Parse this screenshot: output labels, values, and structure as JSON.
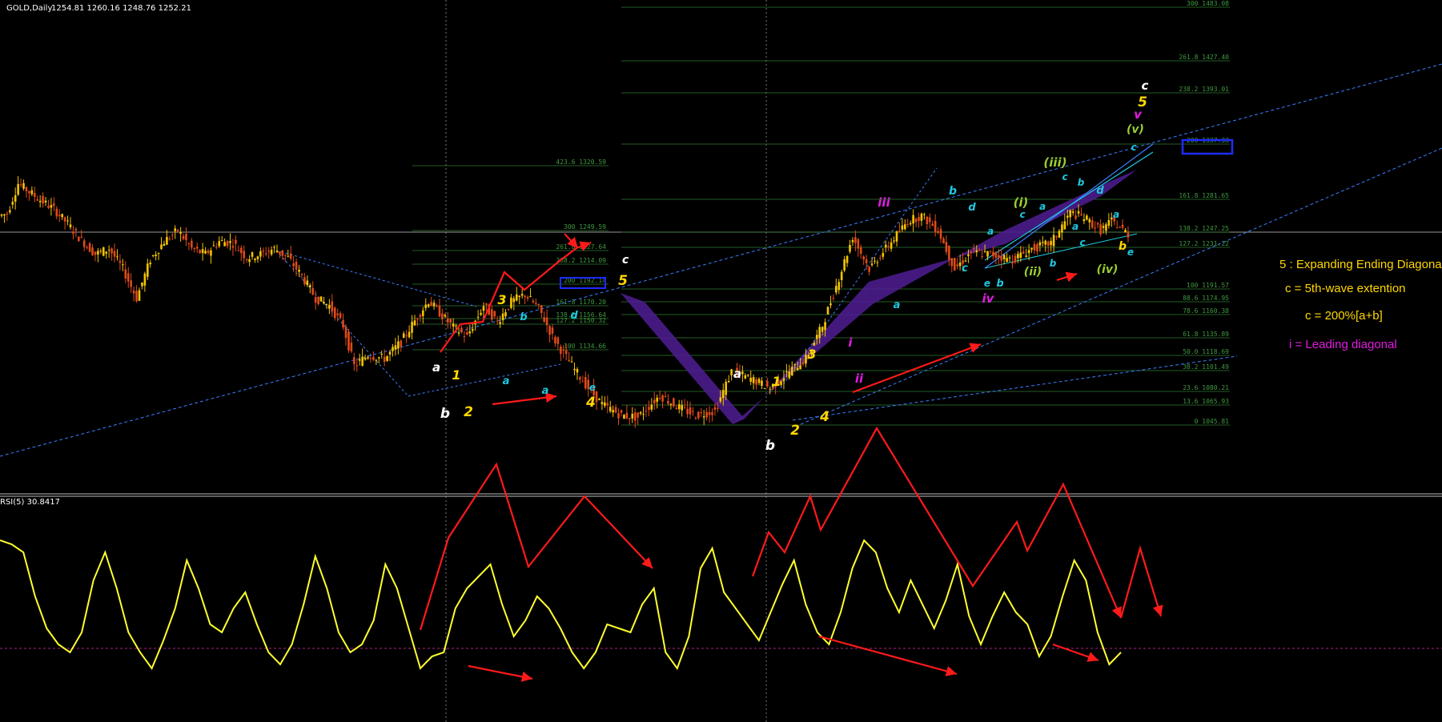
{
  "header": {
    "symbol": "GOLD,Daily",
    "ohlc": "1254.81 1260.16 1248.76 1252.21"
  },
  "rsi": {
    "label": "RSI(5) 30.8417"
  },
  "colors": {
    "background": "#000000",
    "bull": "#f5c400",
    "bear": "#e04a1a",
    "rsi": "#ffff2e",
    "arrows": "#ff1a1a",
    "fib": "#2f7a2f",
    "trend": "#3a7fff",
    "wedge": "#4b1c8c"
  },
  "notes": [
    {
      "text": "5 : Expanding Ending Diagonal",
      "color": "#ffd700"
    },
    {
      "text": "c = 5th-wave extention",
      "color": "#ffd700"
    },
    {
      "text": "c = 200%[a+b]",
      "color": "#ffd700"
    },
    {
      "text": "i = Leading diagonal",
      "color": "#e01ce0"
    }
  ],
  "fib_left": [
    {
      "label": "423.6 1320.59"
    },
    {
      "label": "300 1249.59"
    },
    {
      "label": "261.8 1227.64"
    },
    {
      "label": "238.2 1214.09"
    },
    {
      "label": "200 1192.14"
    },
    {
      "label": "161.8 1170.20"
    },
    {
      "label": "138.2 1156.64"
    },
    {
      "label": "127.2 1150.32"
    },
    {
      "label": "100 1134.66"
    }
  ],
  "fib_right": [
    {
      "label": "300 1483.08"
    },
    {
      "label": "261.8 1427.40"
    },
    {
      "label": "238.2 1393.01"
    },
    {
      "label": "200 1337.33"
    },
    {
      "label": "161.8 1281.65"
    },
    {
      "label": "138.2 1247.25"
    },
    {
      "label": "127.2 1231.22"
    },
    {
      "label": "100 1191.57"
    },
    {
      "label": "88.6 1174.95"
    },
    {
      "label": "78.6 1160.38"
    },
    {
      "label": "61.8 1135.89"
    },
    {
      "label": "50.0 1118.69"
    },
    {
      "label": "38.2 1101.49"
    },
    {
      "label": "23.6 1080.21"
    },
    {
      "label": "13.6 1065.93"
    },
    {
      "label": "0 1045.81"
    }
  ],
  "wave_labels": [
    {
      "text": "a",
      "color": "#ffffff"
    },
    {
      "text": "b",
      "color": "#ffffff"
    },
    {
      "text": "1",
      "color": "#ffd700"
    },
    {
      "text": "2",
      "color": "#ffd700"
    },
    {
      "text": "3",
      "color": "#ffd700"
    },
    {
      "text": "4",
      "color": "#ffd700"
    },
    {
      "text": "a",
      "color": "#1ec8e0"
    },
    {
      "text": "b",
      "color": "#1ec8e0"
    },
    {
      "text": "a",
      "color": "#1ec8e0"
    },
    {
      "text": "d",
      "color": "#1ec8e0"
    },
    {
      "text": "e",
      "color": "#1ec8e0"
    },
    {
      "text": "c",
      "color": "#ffffff"
    },
    {
      "text": "5",
      "color": "#ffd700"
    },
    {
      "text": "a",
      "color": "#ffffff"
    },
    {
      "text": "b",
      "color": "#ffffff"
    },
    {
      "text": "1",
      "color": "#ffd700"
    },
    {
      "text": "2",
      "color": "#ffd700"
    },
    {
      "text": "3",
      "color": "#ffd700"
    },
    {
      "text": "4",
      "color": "#ffd700"
    },
    {
      "text": "i",
      "color": "#e01ce0"
    },
    {
      "text": "ii",
      "color": "#e01ce0"
    },
    {
      "text": "iii",
      "color": "#e01ce0"
    },
    {
      "text": "iv",
      "color": "#e01ce0"
    },
    {
      "text": "v",
      "color": "#e01ce0"
    },
    {
      "text": "a",
      "color": "#1ec8e0"
    },
    {
      "text": "b",
      "color": "#1ec8e0"
    },
    {
      "text": "d",
      "color": "#1ec8e0"
    },
    {
      "text": "a",
      "color": "#1ec8e0"
    },
    {
      "text": "c",
      "color": "#1ec8e0"
    },
    {
      "text": "e",
      "color": "#1ec8e0"
    },
    {
      "text": "b",
      "color": "#1ec8e0"
    },
    {
      "text": "(i)",
      "color": "#9acd32"
    },
    {
      "text": "c",
      "color": "#1ec8e0"
    },
    {
      "text": "a",
      "color": "#1ec8e0"
    },
    {
      "text": "(ii)",
      "color": "#9acd32"
    },
    {
      "text": "b",
      "color": "#1ec8e0"
    },
    {
      "text": "(iii)",
      "color": "#9acd32"
    },
    {
      "text": "c",
      "color": "#1ec8e0"
    },
    {
      "text": "b",
      "color": "#1ec8e0"
    },
    {
      "text": "a",
      "color": "#1ec8e0"
    },
    {
      "text": "c",
      "color": "#1ec8e0"
    },
    {
      "text": "d",
      "color": "#1ec8e0"
    },
    {
      "text": "a",
      "color": "#1ec8e0"
    },
    {
      "text": "e",
      "color": "#1ec8e0"
    },
    {
      "text": "b",
      "color": "#ffd700"
    },
    {
      "text": "(iv)",
      "color": "#9acd32"
    },
    {
      "text": "(v)",
      "color": "#9acd32"
    },
    {
      "text": "c",
      "color": "#1ec8e0"
    },
    {
      "text": "v",
      "color": "#e01ce0"
    },
    {
      "text": "5",
      "color": "#ffd700"
    },
    {
      "text": "c",
      "color": "#ffffff"
    }
  ],
  "chart_data": {
    "type": "line",
    "instrument": "GOLD",
    "timeframe": "Daily",
    "price_panel": {
      "ohlc_last": {
        "open": 1254.81,
        "high": 1260.16,
        "low": 1248.76,
        "close": 1252.21
      },
      "price_path": [
        [
          0,
          1268
        ],
        [
          3,
          1270
        ],
        [
          7,
          1303
        ],
        [
          11,
          1294
        ],
        [
          15,
          1285
        ],
        [
          20,
          1275
        ],
        [
          25,
          1259
        ],
        [
          30,
          1241
        ],
        [
          35,
          1226
        ],
        [
          40,
          1232
        ],
        [
          45,
          1210
        ],
        [
          50,
          1178
        ],
        [
          55,
          1220
        ],
        [
          60,
          1240
        ],
        [
          65,
          1252
        ],
        [
          70,
          1232
        ],
        [
          75,
          1226
        ],
        [
          80,
          1240
        ],
        [
          85,
          1238
        ],
        [
          90,
          1222
        ],
        [
          95,
          1226
        ],
        [
          100,
          1232
        ],
        [
          105,
          1222
        ],
        [
          110,
          1202
        ],
        [
          115,
          1178
        ],
        [
          120,
          1170
        ],
        [
          125,
          1148
        ],
        [
          129,
          1104
        ],
        [
          134,
          1116
        ],
        [
          140,
          1112
        ],
        [
          146,
          1130
        ],
        [
          152,
          1158
        ],
        [
          156,
          1175
        ],
        [
          160,
          1162
        ],
        [
          165,
          1146
        ],
        [
          170,
          1136
        ],
        [
          176,
          1170
        ],
        [
          181,
          1152
        ],
        [
          186,
          1174
        ],
        [
          191,
          1182
        ],
        [
          196,
          1167
        ],
        [
          201,
          1136
        ],
        [
          204,
          1122
        ],
        [
          209,
          1100
        ],
        [
          214,
          1080
        ],
        [
          219,
          1062
        ],
        [
          226,
          1050
        ],
        [
          232,
          1048
        ],
        [
          240,
          1072
        ],
        [
          246,
          1060
        ],
        [
          253,
          1050
        ],
        [
          260,
          1055
        ],
        [
          266,
          1098
        ],
        [
          273,
          1090
        ],
        [
          280,
          1080
        ],
        [
          287,
          1098
        ],
        [
          293,
          1112
        ],
        [
          299,
          1148
        ],
        [
          305,
          1200
        ],
        [
          310,
          1245
        ],
        [
          316,
          1210
        ],
        [
          322,
          1232
        ],
        [
          330,
          1262
        ],
        [
          335,
          1268
        ],
        [
          341,
          1252
        ],
        [
          347,
          1210
        ],
        [
          353,
          1228
        ],
        [
          360,
          1226
        ],
        [
          368,
          1220
        ],
        [
          375,
          1232
        ],
        [
          382,
          1238
        ],
        [
          389,
          1271
        ],
        [
          394,
          1266
        ],
        [
          400,
          1252
        ],
        [
          404,
          1262
        ],
        [
          410,
          1248
        ]
      ]
    },
    "fibonacci_left": [
      {
        "level": 423.6,
        "price": 1320.59
      },
      {
        "level": 300,
        "price": 1249.59
      },
      {
        "level": 261.8,
        "price": 1227.64
      },
      {
        "level": 238.2,
        "price": 1214.09
      },
      {
        "level": 200,
        "price": 1192.14
      },
      {
        "level": 161.8,
        "price": 1170.2
      },
      {
        "level": 138.2,
        "price": 1156.64
      },
      {
        "level": 127.2,
        "price": 1150.32
      },
      {
        "level": 100,
        "price": 1134.66
      }
    ],
    "fibonacci_right": [
      {
        "level": 300,
        "price": 1483.08
      },
      {
        "level": 261.8,
        "price": 1427.4
      },
      {
        "level": 238.2,
        "price": 1393.01
      },
      {
        "level": 200,
        "price": 1337.33
      },
      {
        "level": 161.8,
        "price": 1281.65
      },
      {
        "level": 138.2,
        "price": 1247.25
      },
      {
        "level": 127.2,
        "price": 1231.22
      },
      {
        "level": 100,
        "price": 1191.57
      },
      {
        "level": 88.6,
        "price": 1174.95
      },
      {
        "level": 78.6,
        "price": 1160.38
      },
      {
        "level": 61.8,
        "price": 1135.89
      },
      {
        "level": 50.0,
        "price": 1118.69
      },
      {
        "level": 38.2,
        "price": 1101.49
      },
      {
        "level": 23.6,
        "price": 1080.21
      },
      {
        "level": 13.6,
        "price": 1065.93
      },
      {
        "level": 0,
        "price": 1045.81
      }
    ],
    "rsi_panel": {
      "period": 5,
      "last_value": 30.8417,
      "ylim": [
        0,
        100
      ],
      "values": [
        86,
        84,
        80,
        58,
        42,
        34,
        30,
        40,
        66,
        80,
        62,
        40,
        30,
        22,
        36,
        52,
        76,
        62,
        44,
        40,
        52,
        60,
        44,
        30,
        24,
        34,
        54,
        78,
        62,
        40,
        30,
        34,
        46,
        74,
        62,
        42,
        22,
        28,
        30,
        52,
        62,
        68,
        74,
        54,
        38,
        46,
        58,
        52,
        42,
        30,
        22,
        30,
        44,
        42,
        40,
        54,
        62,
        30,
        22,
        38,
        72,
        82,
        60,
        52,
        44,
        36,
        50,
        64,
        76,
        54,
        40,
        34,
        50,
        72,
        86,
        80,
        62,
        50,
        66,
        54,
        42,
        56,
        74,
        48,
        34,
        48,
        60,
        50,
        44,
        28,
        38,
        58,
        76,
        66,
        40,
        24,
        30
      ]
    }
  }
}
